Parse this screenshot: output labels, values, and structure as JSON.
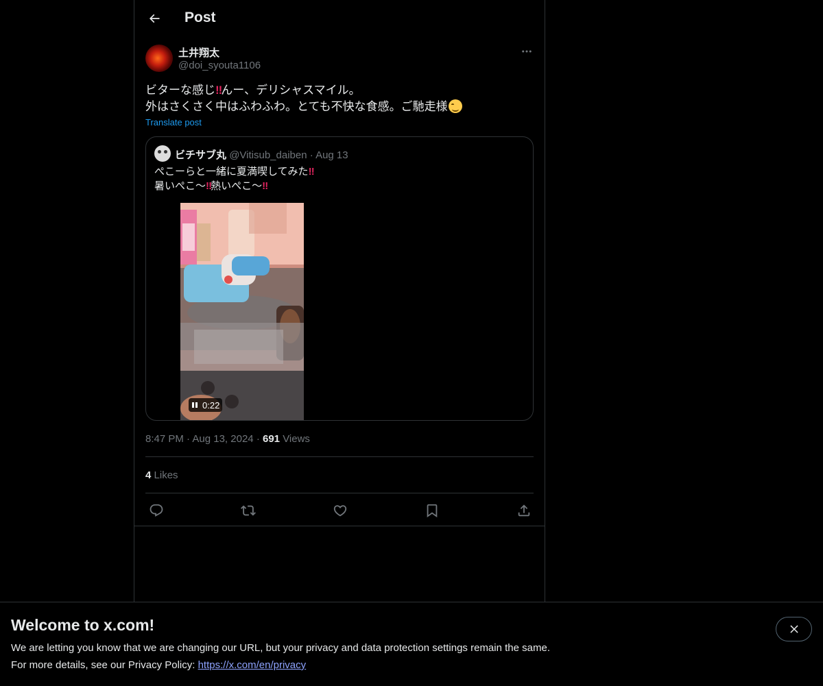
{
  "header": {
    "title": "Post"
  },
  "tweet": {
    "author_name": "土井翔太",
    "author_handle": "@doi_syouta1106",
    "text_line1_a": "ビターな感じ",
    "text_line1_b": "‼",
    "text_line1_c": "んー、デリシャスマイル。",
    "text_line2": "外はさくさく中はふわふわ。とても不快な食感。ご馳走様",
    "translate_label": "Translate post",
    "time": "8:47 PM",
    "date": "Aug 13, 2024",
    "views_count": "691",
    "views_label": "Views",
    "likes_count": "4",
    "likes_label": "Likes"
  },
  "quote": {
    "name": "ビチサブ丸",
    "handle": "@Vitisub_daiben",
    "separator": "·",
    "date": "Aug 13",
    "line1": "ぺこーらと一緒に夏満喫してみた",
    "line2_a": "暑いぺこ〜",
    "line2_b": "熱いぺこ〜",
    "bang": "‼",
    "video_time": "0:22"
  },
  "separator": "·",
  "banner": {
    "title": "Welcome to x.com!",
    "line1": "We are letting you know that we are changing our URL, but your privacy and data protection settings remain the same.",
    "line2_prefix": "For more details, see our Privacy Policy: ",
    "link": "https://x.com/en/privacy"
  },
  "icons": [
    "back-arrow-icon",
    "more-icon",
    "pause-icon",
    "reply-icon",
    "retweet-icon",
    "like-icon",
    "bookmark-icon",
    "share-icon",
    "close-icon"
  ],
  "colors": {
    "background": "#000000",
    "text": "#e7e9ea",
    "muted": "#71767b",
    "link": "#1d9bf0",
    "border": "#2f3336"
  }
}
